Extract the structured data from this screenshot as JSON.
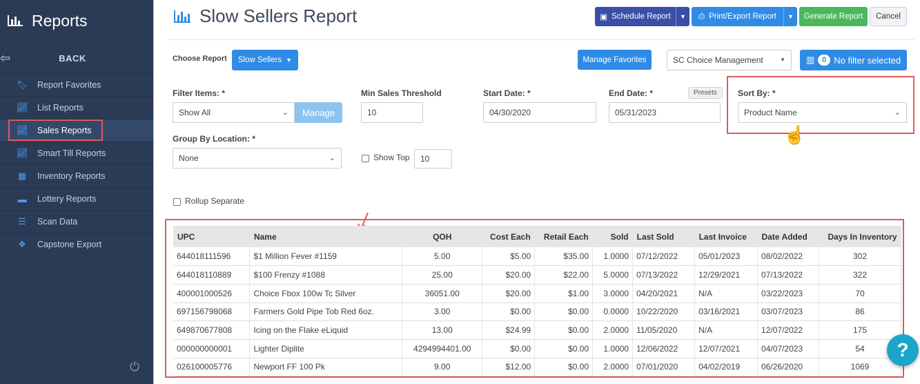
{
  "sidebar": {
    "title": "Reports",
    "back_label": "BACK",
    "items": [
      {
        "label": "Report Favorites"
      },
      {
        "label": "List Reports"
      },
      {
        "label": "Sales Reports"
      },
      {
        "label": "Smart Till Reports"
      },
      {
        "label": "Inventory Reports"
      },
      {
        "label": "Lottery Reports"
      },
      {
        "label": "Scan Data"
      },
      {
        "label": "Capstone Export"
      }
    ],
    "active_index": 2
  },
  "header": {
    "title": "Slow Sellers Report",
    "schedule_label": "Schedule Report",
    "print_label": "Print/Export Report",
    "generate_label": "Generate Report",
    "cancel_label": "Cancel"
  },
  "toolbar": {
    "choose_report_label": "Choose Report",
    "report_select": "Slow Sellers",
    "manage_favorites_label": "Manage Favorites",
    "store_select": "SC Choice Management",
    "filter_count": "0",
    "filter_label": "No filter selected"
  },
  "filters": {
    "filter_items_label": "Filter Items: *",
    "filter_items_value": "Show All",
    "manage_label": "Manage",
    "min_sales_label": "Min Sales Threshold",
    "min_sales_value": "10",
    "start_date_label": "Start Date: *",
    "start_date_value": "04/30/2020",
    "end_date_label": "End Date: *",
    "end_date_value": "05/31/2023",
    "presets_label": "Presets",
    "sort_by_label": "Sort By: *",
    "sort_by_value": "Product Name",
    "group_by_label": "Group By Location: *",
    "group_by_value": "None",
    "show_top_label": "Show Top",
    "show_top_value": "10",
    "rollup_label": "Rollup Separate"
  },
  "table": {
    "columns": [
      "UPC",
      "Name",
      "QOH",
      "Cost Each",
      "Retail Each",
      "Sold",
      "Last Sold",
      "Last Invoice",
      "Date Added",
      "Days In Inventory"
    ],
    "rows": [
      [
        "644018111596",
        "$1 Million Fever #1159",
        "5.00",
        "$5.00",
        "$35.00",
        "1.0000",
        "07/12/2022",
        "05/01/2023",
        "08/02/2022",
        "302"
      ],
      [
        "644018110889",
        "$100 Frenzy #1088",
        "25.00",
        "$20.00",
        "$22.00",
        "5.0000",
        "07/13/2022",
        "12/29/2021",
        "07/13/2022",
        "322"
      ],
      [
        "400001000526",
        "Choice Fbox 100w Tc Silver",
        "36051.00",
        "$20.00",
        "$1.00",
        "3.0000",
        "04/20/2021",
        "N/A",
        "03/22/2023",
        "70"
      ],
      [
        "697156798068",
        "Farmers Gold Pipe Tob Red 6oz.",
        "3.00",
        "$0.00",
        "$0.00",
        "0.0000",
        "10/22/2020",
        "03/16/2021",
        "03/07/2023",
        "86"
      ],
      [
        "649870677808",
        "Icing on the Flake eLiquid",
        "13.00",
        "$24.99",
        "$0.00",
        "2.0000",
        "11/05/2020",
        "N/A",
        "12/07/2022",
        "175"
      ],
      [
        "000000000001",
        "Lighter Diplite",
        "4294994401.00",
        "$0.00",
        "$0.00",
        "1.0000",
        "12/06/2022",
        "12/07/2021",
        "04/07/2023",
        "54"
      ],
      [
        "026100005776",
        "Newport FF 100 Pk",
        "9.00",
        "$12.00",
        "$0.00",
        "2.0000",
        "07/01/2020",
        "04/02/2019",
        "06/26/2020",
        "1069"
      ]
    ]
  },
  "help_label": "?"
}
